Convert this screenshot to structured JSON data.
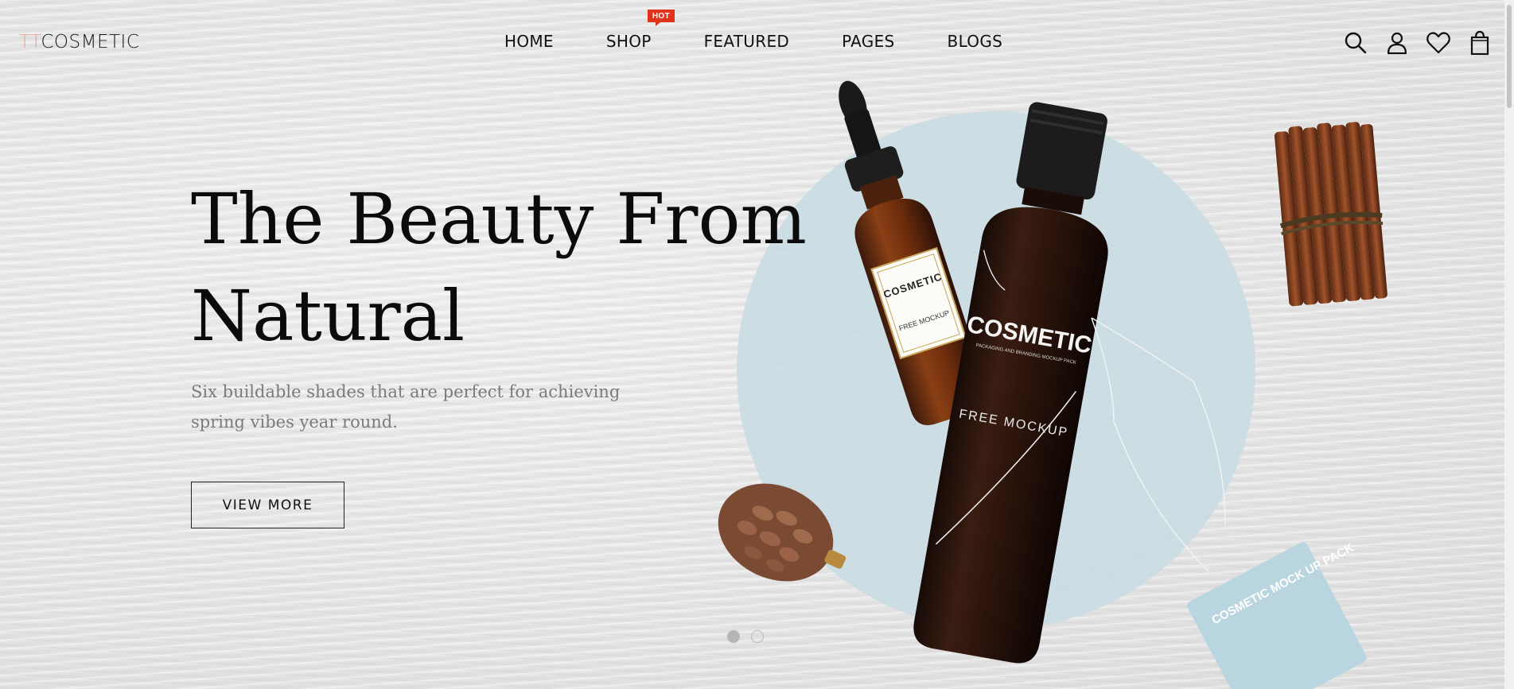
{
  "header": {
    "logo_prefix": "TT",
    "logo_main": "COSMETIC",
    "nav": [
      {
        "label": "HOME"
      },
      {
        "label": "SHOP",
        "badge": "HOT"
      },
      {
        "label": "FEATURED"
      },
      {
        "label": "PAGES"
      },
      {
        "label": "BLOGS"
      }
    ],
    "icons": [
      "search-icon",
      "user-icon",
      "heart-icon",
      "shopping-bag-icon"
    ]
  },
  "hero": {
    "title_line1": "The Beauty From",
    "title_line2": "Natural",
    "subtitle_line1": "Six buildable shades that are perfect for achieving",
    "subtitle_line2": "spring vibes year round.",
    "cta_label": "VIEW MORE",
    "product_labels": {
      "dropper_brand": "COSMETIC",
      "dropper_sub": "FREE MOCKUP",
      "bottle_brand": "COSMETIC",
      "bottle_tagline": "PACKAGING AND BRANDING MOCKUP PACK",
      "bottle_sub": "FREE MOCKUP",
      "tag_text": "COSMETIC MOCK UP PACK"
    }
  },
  "slider": {
    "slide_count": 2,
    "active_index": 0
  },
  "colors": {
    "accent": "#e8a29a",
    "hot_badge": "#e1331a",
    "circle": "#c9dce3"
  }
}
